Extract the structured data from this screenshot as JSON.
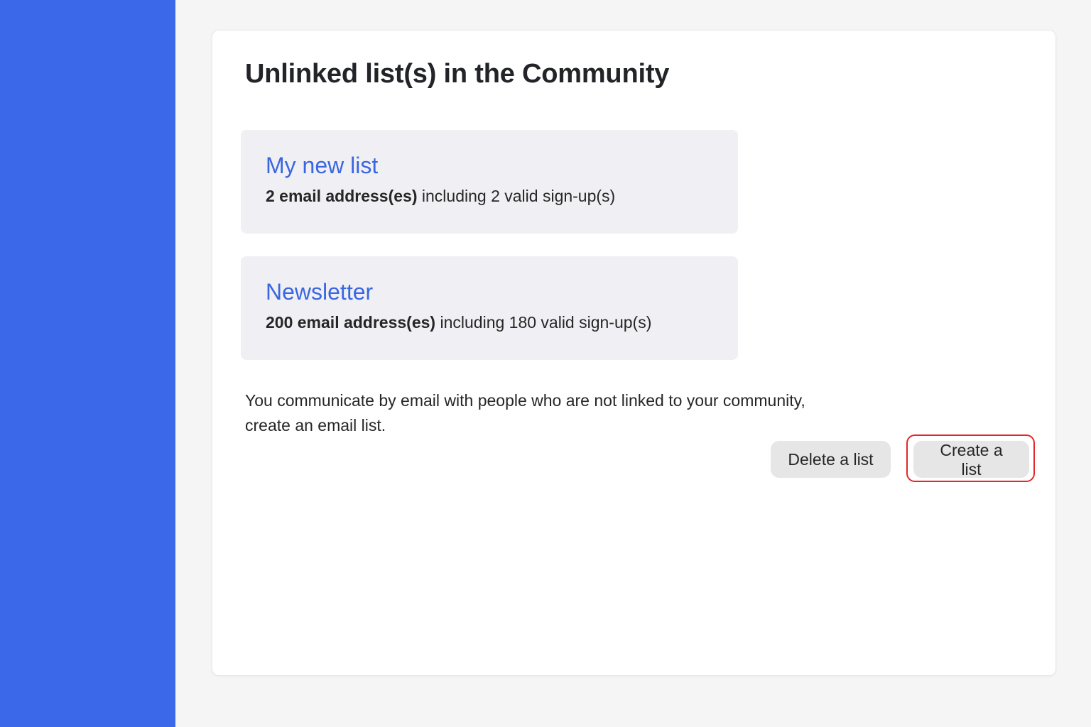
{
  "page": {
    "title": "Unlinked list(s) in the Community"
  },
  "lists": [
    {
      "name": "My new list",
      "count_text": "2 email address(es)",
      "detail_text": " including 2 valid sign-up(s)"
    },
    {
      "name": "Newsletter",
      "count_text": "200 email address(es)",
      "detail_text": " including 180 valid sign-up(s)"
    }
  ],
  "info": {
    "line1": "You communicate by email with people who are not linked to your community,",
    "line2": "create an email list."
  },
  "actions": {
    "delete_label": "Delete a list",
    "create_label": "Create a list"
  },
  "colors": {
    "sidebar": "#3b68e8",
    "link": "#3a66e0",
    "highlight": "#e4262a",
    "card_bg": "#f0f0f4",
    "button_bg": "#e6e6e6"
  }
}
